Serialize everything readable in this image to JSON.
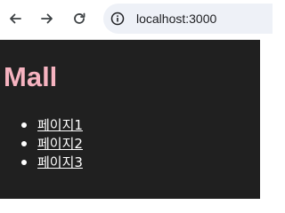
{
  "browser": {
    "url": "localhost:3000",
    "icons": {
      "back": "arrow-left-icon",
      "forward": "arrow-right-icon",
      "reload": "reload-icon",
      "site_info": "info-icon"
    }
  },
  "page": {
    "title": "Mall",
    "links": [
      {
        "label": "페이지1"
      },
      {
        "label": "페이지2"
      },
      {
        "label": "페이지3"
      }
    ],
    "colors": {
      "background": "#202020",
      "title": "#f6b3c0",
      "link": "#ffffff"
    }
  }
}
